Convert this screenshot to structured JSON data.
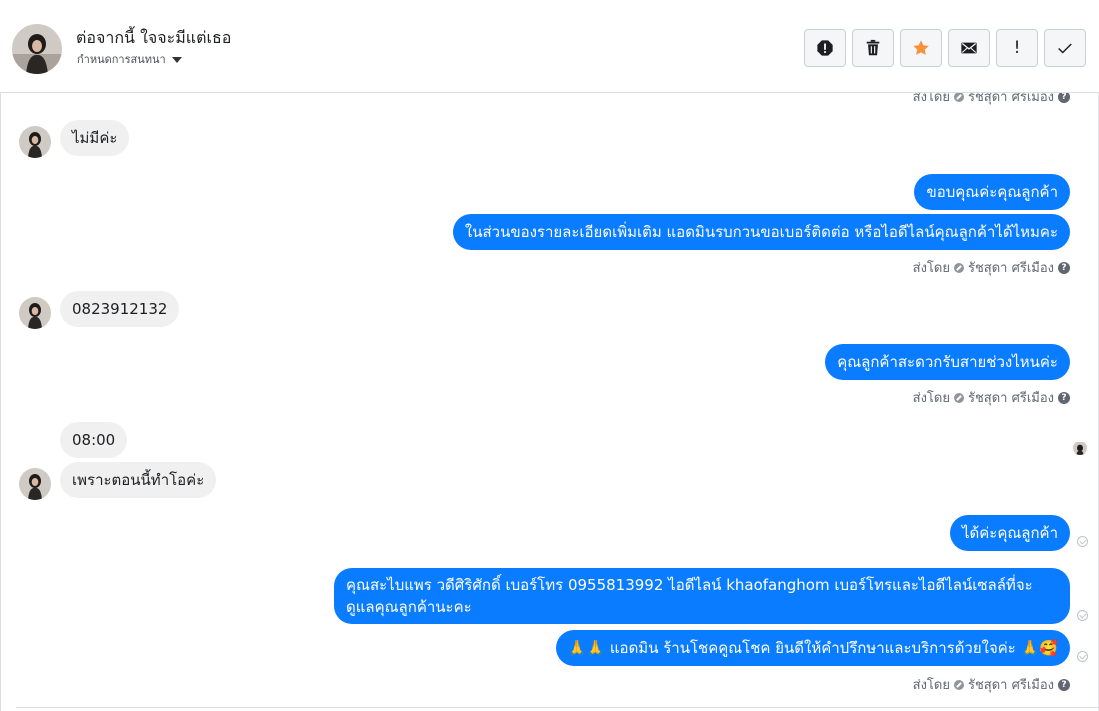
{
  "conversation": {
    "title": "ต่อจากนี้ ใจจะมีแต่เธอ",
    "subtitle": "กำหนดการสนทนา"
  },
  "toolbar": {
    "buttons": [
      "alert-icon",
      "trash-icon",
      "star-icon",
      "mail-icon",
      "exclamation-icon",
      "check-icon"
    ],
    "exclamation_label": "!",
    "colors": {
      "star": "#f7923b",
      "icon": "#1c1e21",
      "bg": "#f5f6f7"
    }
  },
  "sent_by": {
    "prefix": "ส่งโดย",
    "name": "รัชสุดา ศรีเมือง"
  },
  "messages": {
    "m1": "ไม่มีค่ะ",
    "m2": "ขอบคุณค่ะคุณลูกค้า",
    "m3": "ในส่วนของรายละเอียดเพิ่มเติม แอดมินรบกวนขอเบอร์ติดต่อ หรือไอดีไลน์คุณลูกค้าได้ไหมคะ",
    "m4": "0823912132",
    "m5": "คุณลูกค้าสะดวกรับสายช่วงไหนค่ะ",
    "m6": "08:00",
    "m7": "เพราะตอนนี้ทำโอค่ะ",
    "m8": "ได้ค่ะคุณลูกค้า",
    "m9": "คุณสะไบแพร วดีศิริศักดิ์ เบอร์โทร 0955813992  ไอดีไลน์  khaofanghom   เบอร์โทรและไอดีไลน์เซลล์ที่จะดูแลคุณลูกค้านะคะ",
    "m10_prefix": "🙏🙏",
    "m10_text": "แอดมิน ร้านโชคคูณโชค ยินดีให้คำปรึกษาและบริการด้วยใจค่ะ",
    "m10_suffix": "🙏🥰"
  },
  "colors": {
    "outgoing": "#0a7cff",
    "incoming": "#f0f0f0"
  }
}
